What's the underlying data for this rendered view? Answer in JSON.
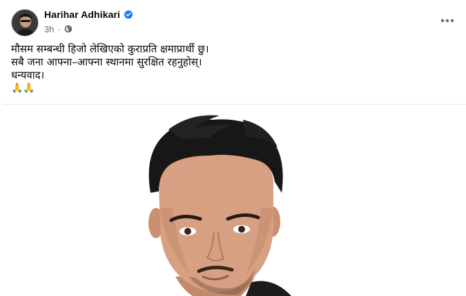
{
  "post": {
    "author": "Harihar Adhikari",
    "time": "3h",
    "separator": "·",
    "privacy_icon": "globe-icon",
    "verified_icon": "verified-badge-icon",
    "more_icon": "more-options-icon",
    "text_lines": [
      "मौसम सम्बन्धी हिजो लेखिएको कुराप्रति क्षमाप्रार्थी छु।",
      "सबै जना आफ्ना–आफ्ना स्थानमा सुरक्षित रहनुहोस्।",
      "धन्यवाद।"
    ],
    "emoji": "🙏🙏"
  },
  "colors": {
    "verified": "#1877f2",
    "secondary_text": "#65676b",
    "divider": "#e4e6eb"
  }
}
